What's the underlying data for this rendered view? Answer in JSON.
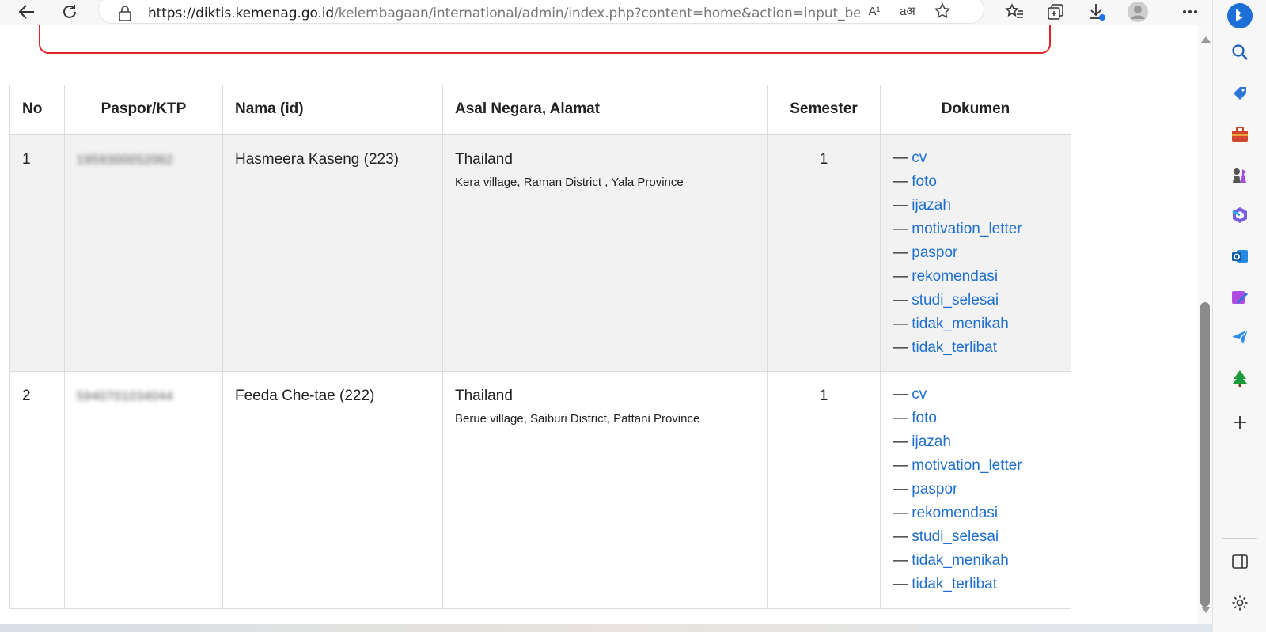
{
  "browser": {
    "url_domain": "https://diktis.kemenag.go.id",
    "url_path": "/kelembagaan/international/admin/index.php?content=home&action=input_beam...",
    "read_aloud_icon": "A¹",
    "translate_icon": "aअ"
  },
  "table": {
    "headers": {
      "no": "No",
      "paspor": "Paspor/KTP",
      "nama": "Nama (id)",
      "asal": "Asal Negara, Alamat",
      "semester": "Semester",
      "dokumen": "Dokumen"
    },
    "dash": "—",
    "rows": [
      {
        "no": "1",
        "paspor": "1959300052062",
        "nama": "Hasmeera Kaseng (223)",
        "negara": "Thailand",
        "alamat": "Kera village, Raman District , Yala Province",
        "semester": "1",
        "docs": [
          "cv",
          "foto",
          "ijazah",
          "motivation_letter",
          "paspor",
          "rekomendasi",
          "studi_selesai",
          "tidak_menikah",
          "tidak_terlibat"
        ]
      },
      {
        "no": "2",
        "paspor": "5940701034044",
        "nama": "Feeda Che-tae (222)",
        "negara": "Thailand",
        "alamat": "Berue village, Saiburi District, Pattani Province",
        "semester": "1",
        "docs": [
          "cv",
          "foto",
          "ijazah",
          "motivation_letter",
          "paspor",
          "rekomendasi",
          "studi_selesai",
          "tidak_menikah",
          "tidak_terlibat"
        ]
      }
    ]
  },
  "colors": {
    "link": "#1f6fd0",
    "alert_border": "#e0262d",
    "row_odd": "#f2f2f2"
  }
}
